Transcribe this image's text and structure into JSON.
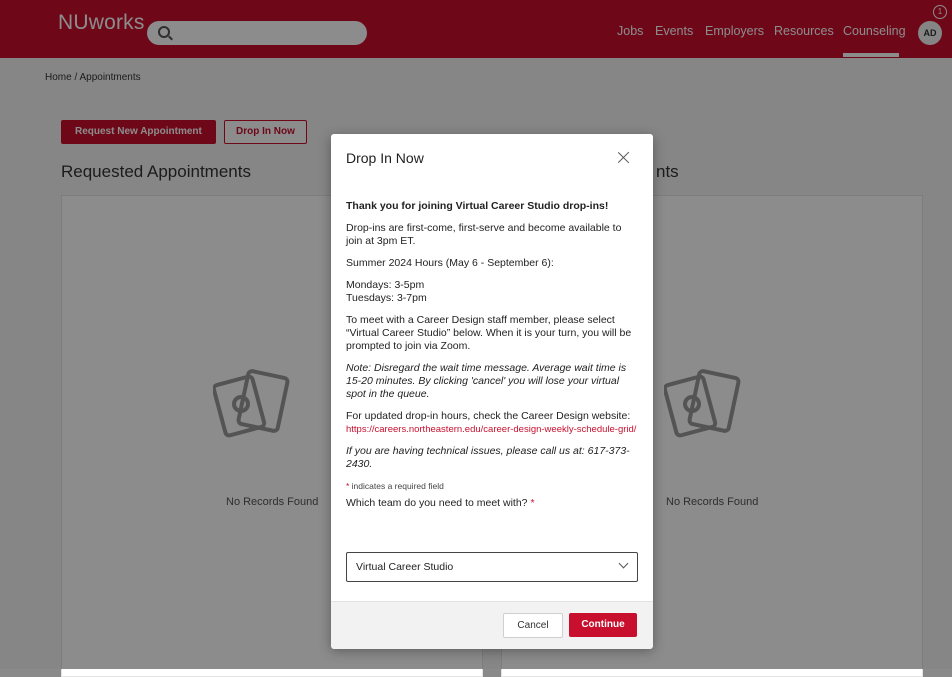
{
  "header": {
    "logo": "NUworks",
    "search_placeholder": "",
    "nav": [
      "Jobs",
      "Events",
      "Employers",
      "Resources",
      "Counseling"
    ],
    "avatar_initials": "AD",
    "notification_count": "1",
    "brand_color": "#c8102e"
  },
  "breadcrumb": "Home / Appointments",
  "actions": {
    "request_new": "Request New Appointment",
    "drop_in_now": "Drop In Now"
  },
  "sections": {
    "requested_title": "Requested Appointments",
    "right_title_partial": "nts",
    "empty_left": "No Records Found",
    "empty_right": "No Records Found"
  },
  "modal": {
    "title": "Drop In Now",
    "heading": "Thank you for joining Virtual Career Studio drop-ins!",
    "p1": "Drop-ins are first-come, first-serve and become available to join at 3pm ET.",
    "p2": "Summer 2024 Hours (May 6 - September 6):",
    "hours_mon": "Mondays: 3-5pm",
    "hours_tue": "Tuesdays: 3-7pm",
    "p3": "To meet with a Career Design staff member, please select “Virtual Career Studio” below. When it is your turn, you will be prompted to join via Zoom.",
    "note": "Note: Disregard the wait time message. Average wait time is 15-20 minutes. By clicking 'cancel' you will lose your virtual spot in the queue.",
    "p4_text": "For updated drop-in hours, check the Career Design website: ",
    "p4_link": "https://careers.northeastern.edu/career-design-weekly-schedule-grid/",
    "tech": "If you are having technical issues, please call us at: 617-373-2430.",
    "required_note": "indicates a required field",
    "team_label": "Which team do you need to meet with?",
    "team_value": "Virtual Career Studio",
    "cancel": "Cancel",
    "continue": "Continue"
  }
}
